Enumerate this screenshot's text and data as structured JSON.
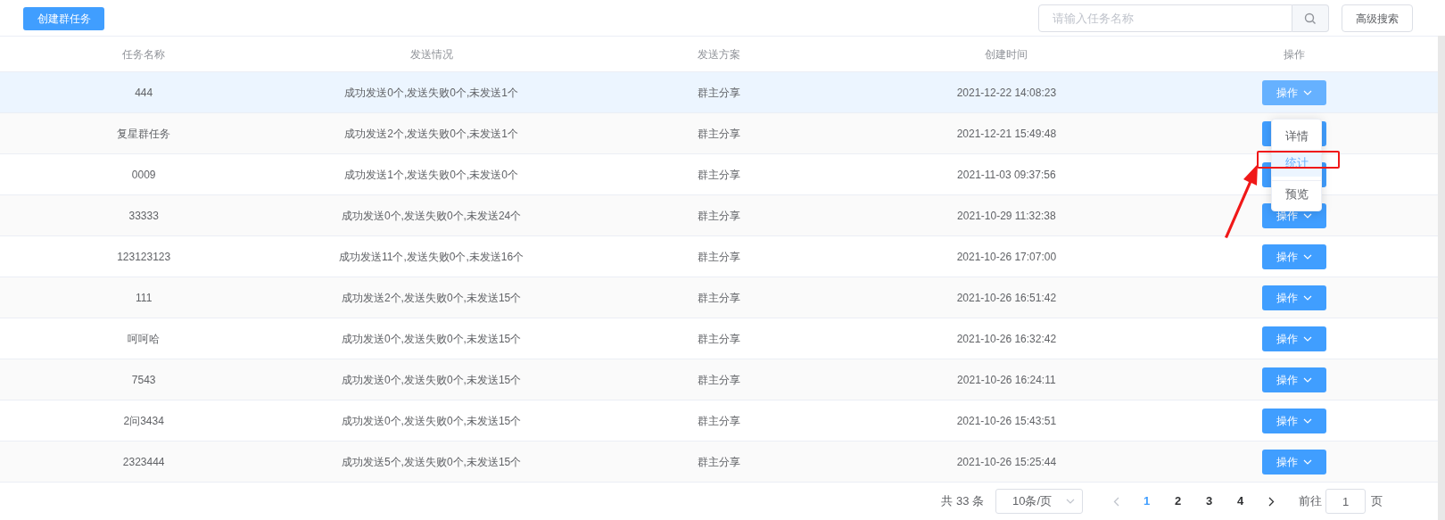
{
  "toolbar": {
    "create_button": "创建群任务",
    "search": {
      "placeholder": "请输入任务名称"
    },
    "advanced_button": "高级搜索"
  },
  "table": {
    "columns": [
      "任务名称",
      "发送情况",
      "发送方案",
      "创建时间",
      "操作"
    ],
    "rows": [
      {
        "name": "444",
        "status": "成功发送0个,发送失败0个,未发送1个",
        "plan": "群主分享",
        "created": "2021-12-22 14:08:23",
        "action": "操作",
        "selected": true
      },
      {
        "name": "复星群任务",
        "status": "成功发送2个,发送失败0个,未发送1个",
        "plan": "群主分享",
        "created": "2021-12-21 15:49:48",
        "selected": false
      },
      {
        "name": "0009",
        "status": "成功发送1个,发送失败0个,未发送0个",
        "plan": "群主分享",
        "created": "2021-11-03 09:37:56",
        "selected": false
      },
      {
        "name": "33333",
        "status": "成功发送0个,发送失败0个,未发送24个",
        "plan": "群主分享",
        "created": "2021-10-29 11:32:38",
        "action": "操作",
        "selected": false
      },
      {
        "name": "123123123",
        "status": "成功发送11个,发送失败0个,未发送16个",
        "plan": "群主分享",
        "created": "2021-10-26 17:07:00",
        "action": "操作",
        "selected": false
      },
      {
        "name": "111",
        "status": "成功发送2个,发送失败0个,未发送15个",
        "plan": "群主分享",
        "created": "2021-10-26 16:51:42",
        "action": "操作",
        "selected": false
      },
      {
        "name": "呵呵哈",
        "status": "成功发送0个,发送失败0个,未发送15个",
        "plan": "群主分享",
        "created": "2021-10-26 16:32:42",
        "action": "操作",
        "selected": false
      },
      {
        "name": "7543",
        "status": "成功发送0个,发送失败0个,未发送15个",
        "plan": "群主分享",
        "created": "2021-10-26 16:24:11",
        "action": "操作",
        "selected": false
      },
      {
        "name": "2问3434",
        "status": "成功发送0个,发送失败0个,未发送15个",
        "plan": "群主分享",
        "created": "2021-10-26 15:43:51",
        "action": "操作",
        "selected": false
      },
      {
        "name": "2323444",
        "status": "成功发送5个,发送失败0个,未发送15个",
        "plan": "群主分享",
        "created": "2021-10-26 15:25:44",
        "action": "操作",
        "selected": false
      }
    ]
  },
  "dropdown_menu": {
    "items": [
      {
        "label": "详情",
        "hovered": false
      },
      {
        "label": "统计",
        "hovered": true
      },
      {
        "label": "预览",
        "hovered": false
      }
    ]
  },
  "pagination": {
    "total": "共 33 条",
    "page_size": "10条/页",
    "pages": [
      {
        "label": "1",
        "selected": true
      },
      {
        "label": "2",
        "selected": false
      },
      {
        "label": "3",
        "selected": false
      },
      {
        "label": "4",
        "selected": false
      }
    ],
    "goto_label": "前往",
    "goto_value": "1",
    "page_suffix": "页"
  }
}
